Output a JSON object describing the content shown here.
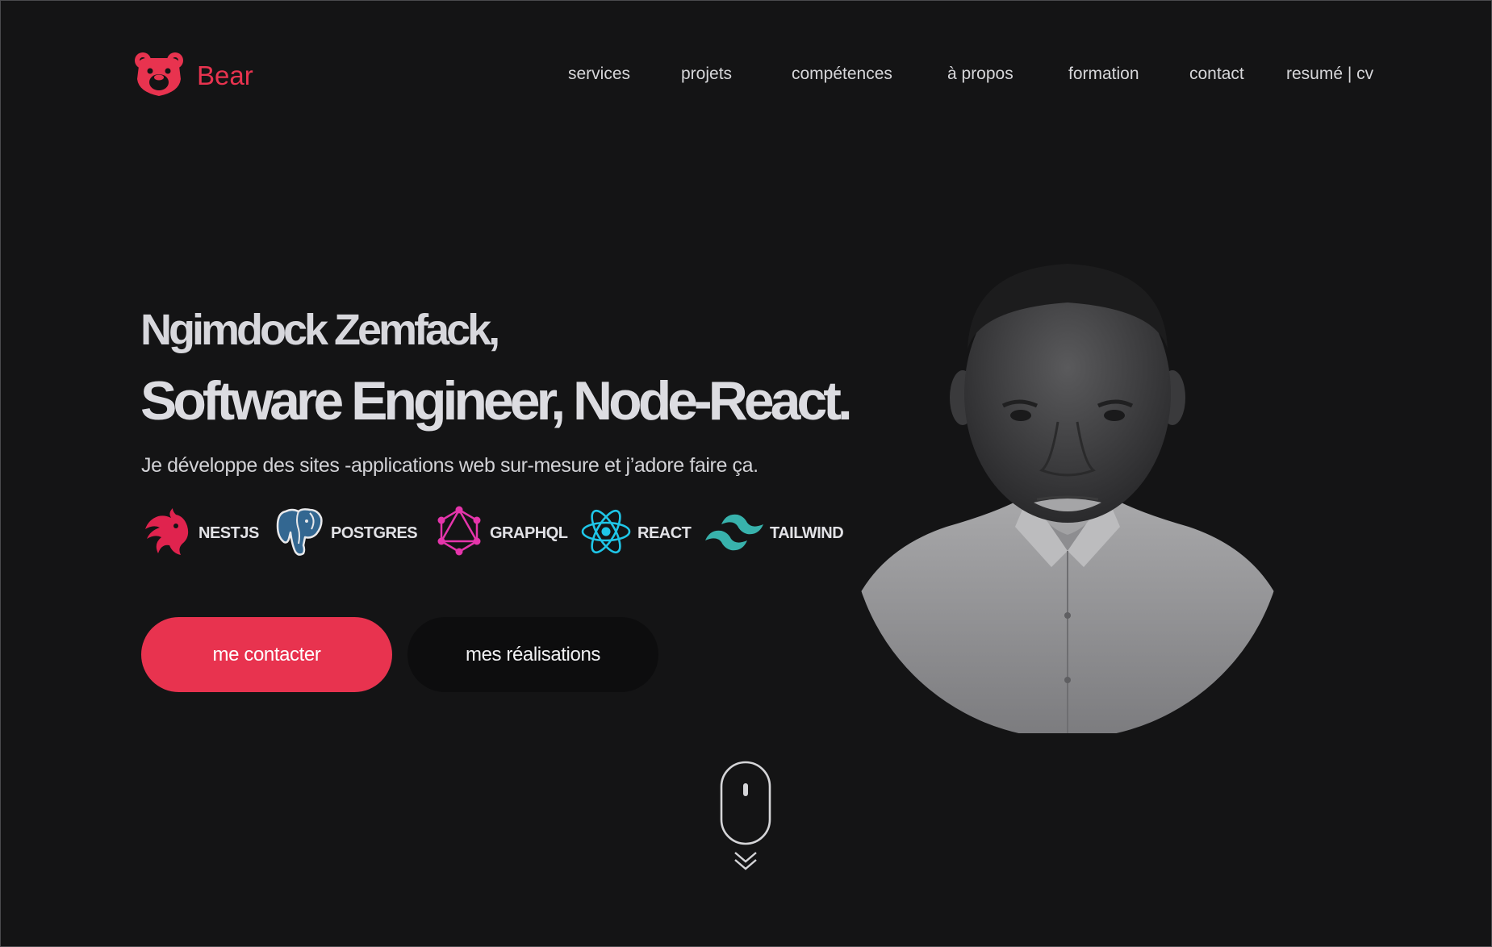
{
  "brand": {
    "name": "Bear",
    "logo_icon": "bear-head-icon",
    "accent_color": "#e8334f"
  },
  "nav": {
    "items": [
      "services",
      "projets",
      "compétences",
      "à propos",
      "formation",
      "contact",
      "resumé | cv"
    ]
  },
  "hero": {
    "name": "Ngimdock Zemfack,",
    "role": "Software Engineer, Node-React.",
    "tagline": "Je développe des sites -applications web sur-mesure et j’adore faire ça.",
    "stack": [
      {
        "label": "NESTJS",
        "icon": "nestjs-icon",
        "color": "#e0234e"
      },
      {
        "label": "POSTGRES",
        "icon": "postgres-elephant-icon",
        "color": "#336791"
      },
      {
        "label": "GRAPHQL",
        "icon": "graphql-icon",
        "color": "#e535ab"
      },
      {
        "label": "REACT",
        "icon": "react-atom-icon",
        "color": "#1fc6e8"
      },
      {
        "label": "TAILWIND",
        "icon": "tailwind-wave-icon",
        "color": "#38b2ac"
      }
    ],
    "primary_button": "me contacter",
    "secondary_button": "mes réalisations"
  },
  "profile_photo": {
    "icon": "profile-photo"
  },
  "scroll_hint": {
    "icon": "mouse-scroll-icon"
  }
}
